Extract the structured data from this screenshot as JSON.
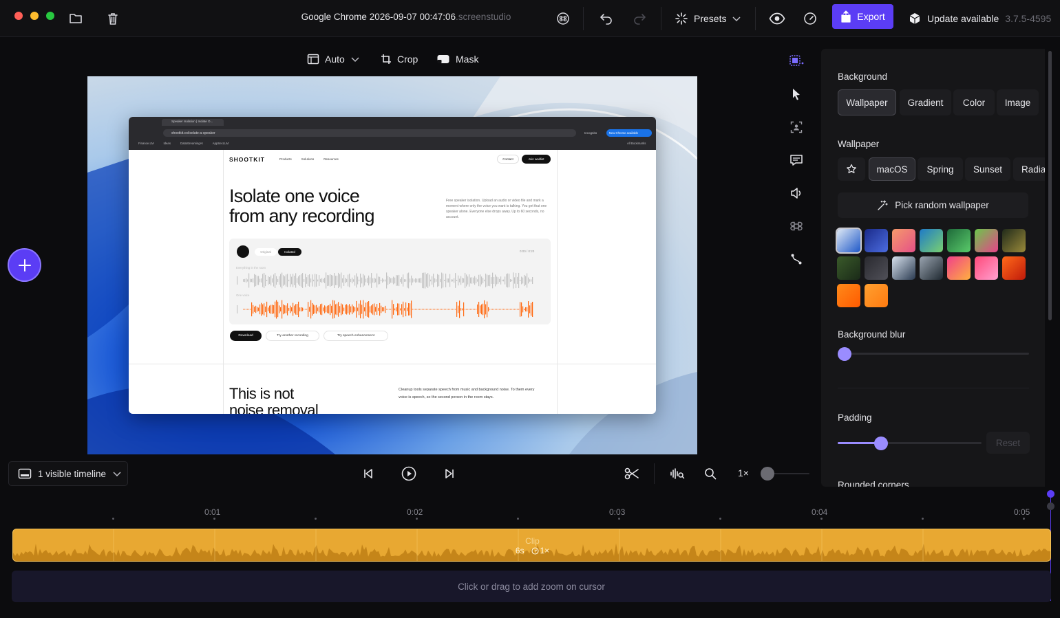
{
  "window": {
    "title": "Google Chrome 2026-09-07 00:47:06",
    "title_suffix": ".screenstudio",
    "traffic_lights": {
      "close": "#ff5f57",
      "minimize": "#febc2e",
      "zoom": "#28c840"
    }
  },
  "toolbar": {
    "presets_label": "Presets",
    "export_label": "Export",
    "update_label": "Update available",
    "update_version": "3.7.5-4595"
  },
  "canvas_tools": {
    "auto_label": "Auto",
    "crop_label": "Crop",
    "mask_label": "Mask"
  },
  "recording": {
    "tab_title": "Speaker Isolation | Isolate O...",
    "url": "shootkit.co/isolate-a-speaker",
    "bookmarks": [
      "Finance.LM",
      "Ideas",
      "DataStreamingAI",
      "AppSecLLM"
    ],
    "all_bookmarks": "All Bookmarks",
    "incognito": "Incognito",
    "new_chrome": "New Chrome available",
    "brand": "SHOOTKIT",
    "nav": [
      "Products",
      "Solutions",
      "Resources"
    ],
    "contact": "Contact",
    "join": "Join waitlist",
    "headline_1": "Isolate one voice",
    "headline_2": "from any recording",
    "description": "Free speaker isolation. Upload an audio or video file and mark a moment where only the voice you want is talking. You get that one speaker alone. Everyone else drops away. Up to 60 seconds, no account.",
    "player_tab_original": "Original",
    "player_tab_isolated": "Isolated",
    "player_time": "0:00 / 0:20",
    "track_label_1": "Everything in the room",
    "track_label_2": "One voice",
    "download": "Download",
    "try_another": "Try another recording",
    "try_speech": "Try speech enhancement",
    "section_headline_1": "This is not",
    "section_headline_2": "noise removal",
    "section_text": "Cleanup tools separate speech from music and background noise. To them every voice is speech, so the second person in the room stays."
  },
  "panel": {
    "background_label": "Background",
    "background_tabs": [
      "Wallpaper",
      "Gradient",
      "Color",
      "Image"
    ],
    "wallpaper_label": "Wallpaper",
    "wallpaper_tabs": [
      "macOS",
      "Spring",
      "Sunset",
      "Radia"
    ],
    "random_label": "Pick random wallpaper",
    "blur_label": "Background blur",
    "blur_value": 0,
    "padding_label": "Padding",
    "padding_value": 0.3,
    "reset_label": "Reset",
    "rounded_label": "Rounded corners",
    "swatches": [
      [
        "#dfe9f5",
        "#1e58c8"
      ],
      [
        "#1a2a8a",
        "#4c6de0"
      ],
      [
        "#f59a6a",
        "#e55088"
      ],
      [
        "#1e7ac8",
        "#7ad070"
      ],
      [
        "#1e6a3a",
        "#5acb6a"
      ],
      [
        "#6ac84a",
        "#e8428a"
      ],
      [
        "#202a1a",
        "#9a8a3a"
      ],
      [
        "#3a5a2a",
        "#1a2a18"
      ],
      [
        "#2a2a30",
        "#505058"
      ],
      [
        "#d8e2ee",
        "#2a3a50"
      ],
      [
        "#9aa4b0",
        "#1e2830"
      ],
      [
        "#f0408a",
        "#ffb040"
      ],
      [
        "#ff4a7a",
        "#ffa0d0"
      ],
      [
        "#ff6a1a",
        "#c01a0a"
      ],
      [
        "#ff8a1a",
        "#ff5a00"
      ],
      [
        "#ffa030",
        "#ff7a10"
      ]
    ]
  },
  "timeline": {
    "visible_label": "1 visible timeline",
    "speed_label": "1×",
    "ticks": [
      "0:01",
      "0:02",
      "0:03",
      "0:04",
      "0:05"
    ],
    "clip_label": "Clip",
    "clip_duration": "6s",
    "clip_speed": "1×",
    "zoom_hint": "Click or drag to add zoom on cursor"
  }
}
